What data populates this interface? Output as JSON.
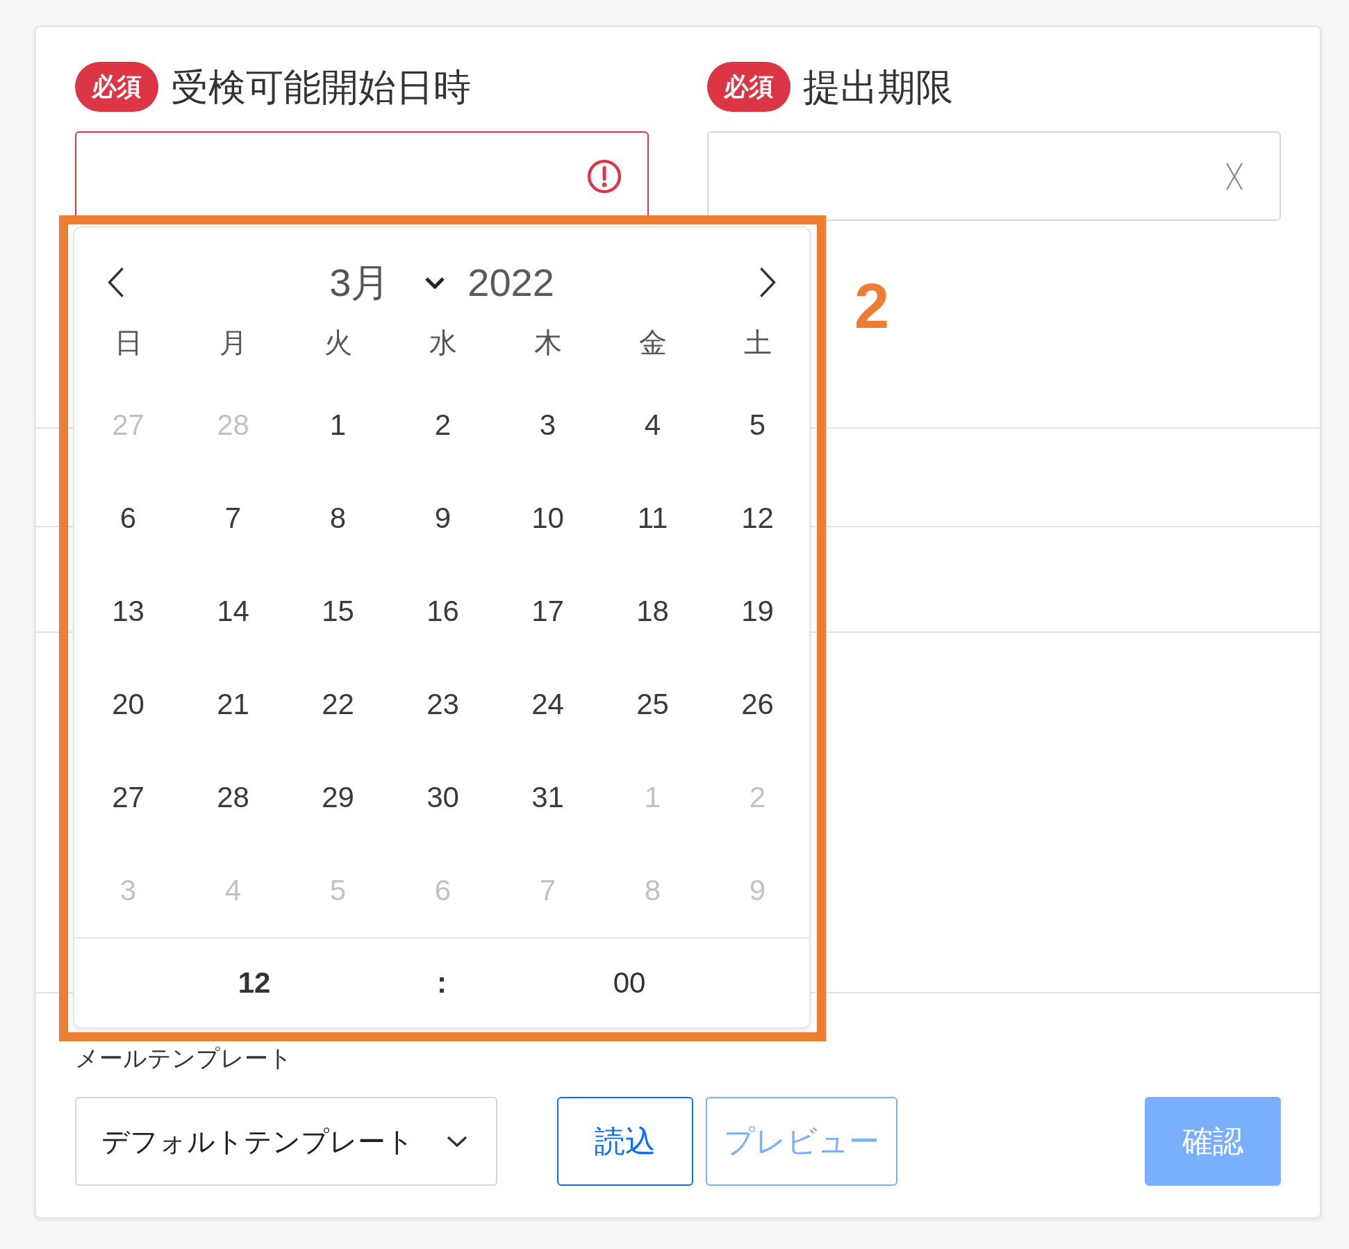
{
  "fields": [
    {
      "badge": "必須",
      "label": "受検可能開始日時",
      "invalid": true
    },
    {
      "badge": "必須",
      "label": "提出期限",
      "invalid": false
    }
  ],
  "date_picker": {
    "month": "3月",
    "year": "2022",
    "weekdays": [
      "日",
      "月",
      "火",
      "水",
      "木",
      "金",
      "土"
    ],
    "days": [
      {
        "label": "27",
        "outside_month": true
      },
      {
        "label": "28",
        "outside_month": true
      },
      {
        "label": "1",
        "outside_month": false
      },
      {
        "label": "2",
        "outside_month": false
      },
      {
        "label": "3",
        "outside_month": false
      },
      {
        "label": "4",
        "outside_month": false
      },
      {
        "label": "5",
        "outside_month": false
      },
      {
        "label": "6",
        "outside_month": false
      },
      {
        "label": "7",
        "outside_month": false
      },
      {
        "label": "8",
        "outside_month": false
      },
      {
        "label": "9",
        "outside_month": false
      },
      {
        "label": "10",
        "outside_month": false
      },
      {
        "label": "11",
        "outside_month": false
      },
      {
        "label": "12",
        "outside_month": false
      },
      {
        "label": "13",
        "outside_month": false
      },
      {
        "label": "14",
        "outside_month": false
      },
      {
        "label": "15",
        "outside_month": false
      },
      {
        "label": "16",
        "outside_month": false
      },
      {
        "label": "17",
        "outside_month": false
      },
      {
        "label": "18",
        "outside_month": false
      },
      {
        "label": "19",
        "outside_month": false
      },
      {
        "label": "20",
        "outside_month": false
      },
      {
        "label": "21",
        "outside_month": false
      },
      {
        "label": "22",
        "outside_month": false
      },
      {
        "label": "23",
        "outside_month": false
      },
      {
        "label": "24",
        "outside_month": false
      },
      {
        "label": "25",
        "outside_month": false
      },
      {
        "label": "26",
        "outside_month": false
      },
      {
        "label": "27",
        "outside_month": false
      },
      {
        "label": "28",
        "outside_month": false
      },
      {
        "label": "29",
        "outside_month": false
      },
      {
        "label": "30",
        "outside_month": false
      },
      {
        "label": "31",
        "outside_month": false
      },
      {
        "label": "1",
        "outside_month": true
      },
      {
        "label": "2",
        "outside_month": true
      },
      {
        "label": "3",
        "outside_month": true
      },
      {
        "label": "4",
        "outside_month": true
      },
      {
        "label": "5",
        "outside_month": true
      },
      {
        "label": "6",
        "outside_month": true
      },
      {
        "label": "7",
        "outside_month": true
      },
      {
        "label": "8",
        "outside_month": true
      },
      {
        "label": "9",
        "outside_month": true
      }
    ],
    "time": {
      "hour": "12",
      "separator": ":",
      "minute": "00"
    }
  },
  "template": {
    "label": "メールテンプレート",
    "select": "デフォルトテンプレート"
  },
  "buttons": [
    {
      "label": "読込",
      "kind": "outline",
      "disabled": false
    },
    {
      "label": "プレビュー",
      "kind": "outline",
      "disabled": true
    },
    {
      "label": "確認",
      "kind": "primary",
      "disabled": true
    }
  ],
  "annotation": {
    "label": "2"
  }
}
